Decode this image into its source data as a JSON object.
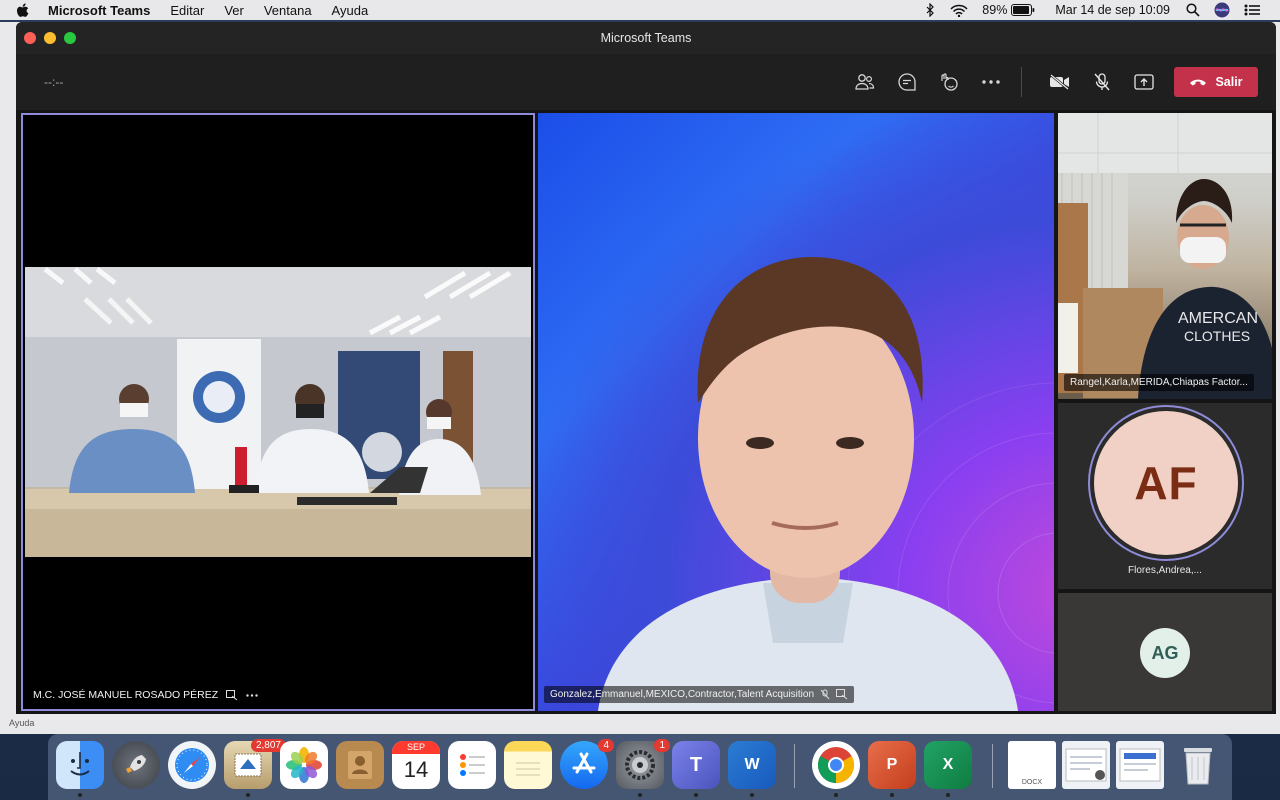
{
  "menubar": {
    "app_name": "Microsoft Teams",
    "menus": [
      "Editar",
      "Ver",
      "Ventana",
      "Ayuda"
    ],
    "battery": "89%",
    "datetime": "Mar 14 de sep  10:09"
  },
  "background_app": {
    "help_label": "Ayuda"
  },
  "window": {
    "title": "Microsoft Teams"
  },
  "toolbar": {
    "timer": "--:--",
    "leave_label": "Salir"
  },
  "tiles": {
    "main_room": {
      "name": "M.C. JOSÉ MANUEL ROSADO PÉREZ"
    },
    "speaker": {
      "name": "Gonzalez,Emmanuel,MEXICO,Contractor,Talent Acquisition"
    },
    "camera_small": {
      "name": "Rangel,Karla,MERIDA,Chiapas Factor..."
    },
    "avatar_af": {
      "initials": "AF",
      "name": "Flores,Andrea,..."
    },
    "avatar_ag": {
      "initials": "AG"
    }
  },
  "dock": {
    "mail_badge": "2,807",
    "calendar_month": "SEP",
    "calendar_day": "14",
    "appstore_badge": "4",
    "settings_badge": "1",
    "doc_label": "DOCX"
  },
  "colors": {
    "accent": "#8e8bd8",
    "leave": "#c4314b"
  }
}
